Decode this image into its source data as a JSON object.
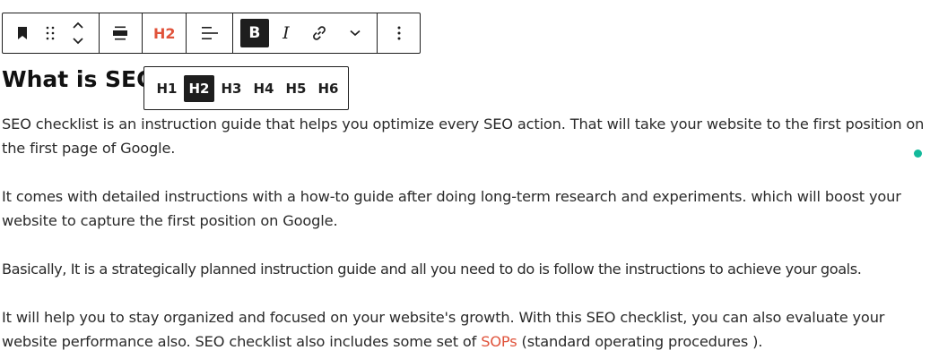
{
  "toolbar": {
    "icons": {
      "block_type": "bookmark-icon",
      "drag": "drag-handle-icon",
      "move": "chevron-up-down-icon",
      "align": "align-wide-icon",
      "text_align": "text-align-left-icon",
      "link": "link-icon",
      "more_formats": "chevron-down-icon",
      "options": "more-vertical-icon"
    },
    "heading_level_label": "H2",
    "bold_label": "B",
    "italic_label": "I",
    "accent_color": "#e0533b"
  },
  "heading_levels": {
    "options": [
      "H1",
      "H2",
      "H3",
      "H4",
      "H5",
      "H6"
    ],
    "selected": "H2"
  },
  "heading": {
    "text": "What is SEO"
  },
  "paragraphs": {
    "p1_link": "SEO checklist",
    "p1_rest": " is an instruction guide that helps you optimize every SEO action. That will take your website to the first position on the first page of Google.",
    "p2": "It comes with detailed instructions with a how-to guide after doing long-term research and experiments. which will boost your website to capture the first position on Google.",
    "p3": "Basically, It is a strategically planned instruction guide and all you need to do is follow the instructions to achieve your goals.",
    "p4_before": "It will help you to stay organized and focused on your website's growth. With this SEO checklist, you can also evaluate your website performance also. SEO checklist also includes some set of ",
    "p4_link": "SOPs",
    "p4_after": " (standard operating procedures )."
  },
  "status_dot_color": "#13b99b"
}
